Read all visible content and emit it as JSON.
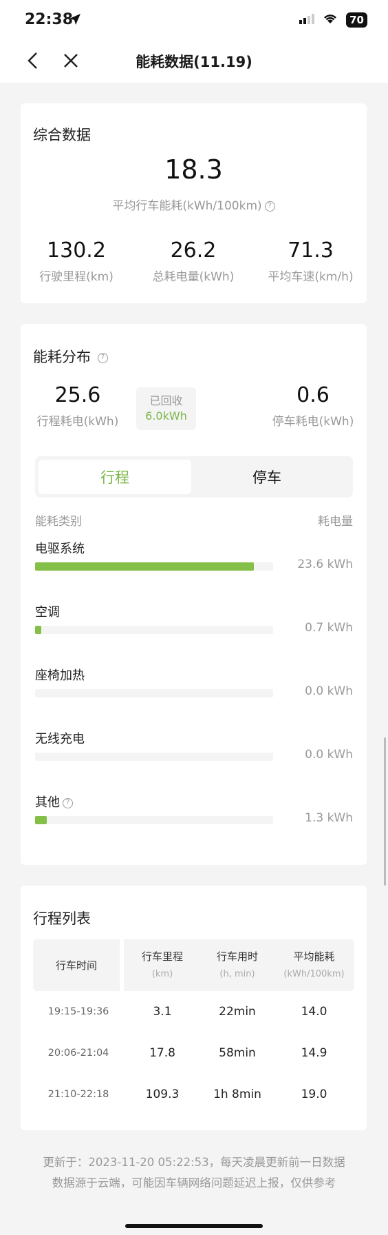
{
  "status": {
    "time": "22:38",
    "battery": "70"
  },
  "nav": {
    "title": "能耗数据(11.19)"
  },
  "summary": {
    "title": "综合数据",
    "avg_value": "18.3",
    "avg_label": "平均行车能耗(kWh/100km)",
    "stats": [
      {
        "value": "130.2",
        "label": "行驶里程(km)"
      },
      {
        "value": "26.2",
        "label": "总耗电量(kWh)"
      },
      {
        "value": "71.3",
        "label": "平均车速(km/h)"
      }
    ]
  },
  "distribution": {
    "title": "能耗分布",
    "driving_value": "25.6",
    "driving_label": "行程耗电(kWh)",
    "recovered_label": "已回收",
    "recovered_value": "6.0kWh",
    "parking_value": "0.6",
    "parking_label": "停车耗电(kWh)",
    "tabs": [
      "行程",
      "停车"
    ],
    "header_category": "能耗类别",
    "header_amount": "耗电量",
    "categories": [
      {
        "label": "电驱系统",
        "value": "23.6 kWh",
        "fraction": 0.92
      },
      {
        "label": "空调",
        "value": "0.7 kWh",
        "fraction": 0.025
      },
      {
        "label": "座椅加热",
        "value": "0.0 kWh",
        "fraction": 0
      },
      {
        "label": "无线充电",
        "value": "0.0 kWh",
        "fraction": 0
      },
      {
        "label": "其他",
        "value": "1.3 kWh",
        "fraction": 0.05
      }
    ]
  },
  "trips": {
    "title": "行程列表",
    "headers": [
      {
        "main": "行车时间",
        "sub": ""
      },
      {
        "main": "行车里程",
        "sub": "(km)"
      },
      {
        "main": "行车用时",
        "sub": "(h, min)"
      },
      {
        "main": "平均能耗",
        "sub": "(kWh/100km)"
      }
    ],
    "rows": [
      [
        "19:15-19:36",
        "3.1",
        "22min",
        "14.0"
      ],
      [
        "20:06-21:04",
        "17.8",
        "58min",
        "14.9"
      ],
      [
        "21:10-22:18",
        "109.3",
        "1h 8min",
        "19.0"
      ]
    ]
  },
  "footer": {
    "line1": "更新于：2023-11-20 05:22:53，每天凌晨更新前一日数据",
    "line2": "数据源于云端，可能因车辆网络问题延迟上报，仅供参考"
  },
  "colors": {
    "accent": "#84bf48",
    "accent_text": "#7ab648"
  }
}
